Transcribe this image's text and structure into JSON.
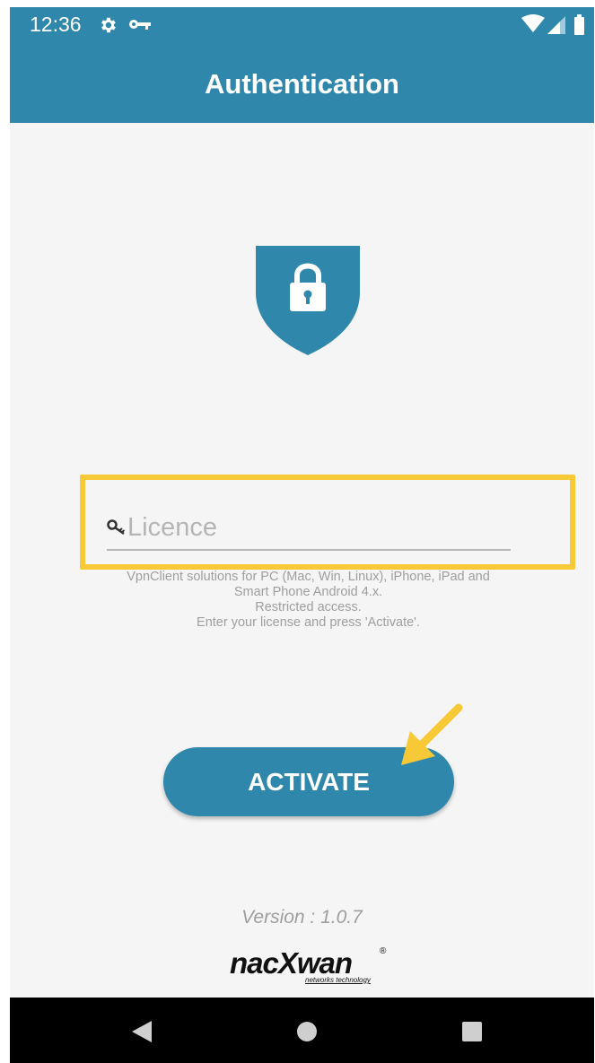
{
  "status_bar": {
    "time": "12:36",
    "left_icons": [
      "gear-icon",
      "vpn-key-icon"
    ],
    "right_icons": [
      "wifi-icon",
      "signal-icon",
      "battery-icon"
    ]
  },
  "app_bar": {
    "title": "Authentication"
  },
  "shield": {
    "icon": "shield-lock-icon",
    "color": "#2f87ab"
  },
  "licence": {
    "placeholder": "Licence",
    "value": "",
    "icon": "key-icon"
  },
  "info_lines": [
    "VpnClient solutions for PC (Mac, Win, Linux), iPhone, iPad and",
    "Smart Phone Android 4.x.",
    "Restricted access.",
    "Enter your license and press 'Activate'."
  ],
  "activate_button": {
    "label": "ACTIVATE"
  },
  "version": "Version : 1.0.7",
  "logo": {
    "text": "nacXwan",
    "registered": "®",
    "subtitle": "networks technology"
  },
  "nav_bar": {
    "icons": [
      "back-icon",
      "home-icon",
      "recents-icon"
    ]
  },
  "colors": {
    "primary": "#2f87ab",
    "highlight": "#f8c936",
    "background": "#f5f5f5"
  }
}
